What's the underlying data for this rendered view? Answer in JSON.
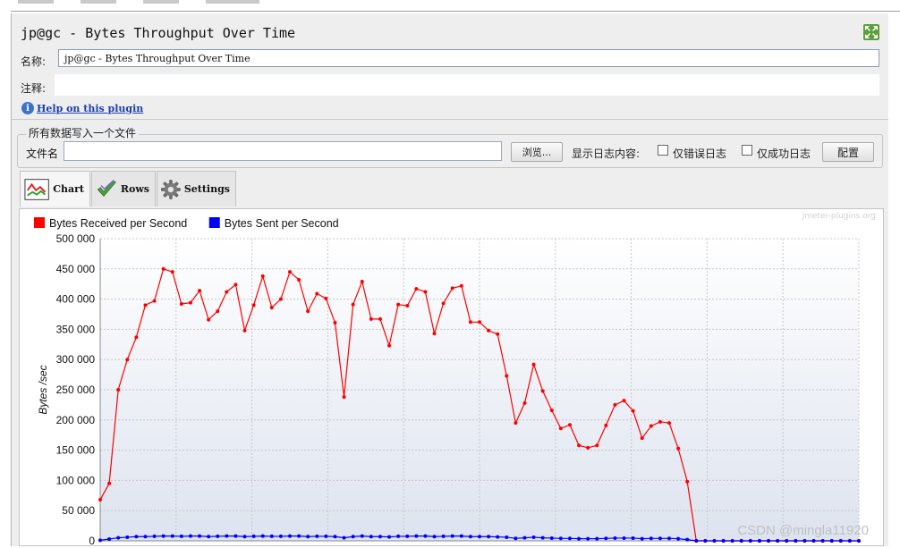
{
  "window": {
    "title": "jp@gc - Bytes Throughput Over Time"
  },
  "form": {
    "name_label": "名称:",
    "name_value": "jp@gc - Bytes Throughput Over Time",
    "comment_label": "注释:",
    "help_link": "Help on this plugin"
  },
  "file": {
    "group_title": "所有数据写入一个文件",
    "filename_label": "文件名",
    "filename_value": "",
    "browse_button": "浏览...",
    "log_display_label": "显示日志内容:",
    "errors_only_label": "仅错误日志",
    "success_only_label": "仅成功日志",
    "config_button": "配置"
  },
  "tabs": [
    {
      "label": "Chart",
      "icon": "chart-icon",
      "active": true
    },
    {
      "label": "Rows",
      "icon": "checkmark-icon",
      "active": false
    },
    {
      "label": "Settings",
      "icon": "gear-icon",
      "active": false
    }
  ],
  "chart": {
    "watermark": "jmeter-plugins.org",
    "footer_watermark": "CSDN @mingla11920"
  },
  "colors": {
    "received": "#ff0000",
    "sent": "#0000ff"
  },
  "chart_data": {
    "type": "line",
    "ylabel": "Bytes /sec",
    "ylim": [
      0,
      500000
    ],
    "yticks": [
      0,
      50000,
      100000,
      150000,
      200000,
      250000,
      300000,
      350000,
      400000,
      450000,
      500000
    ],
    "ytick_labels": [
      "0",
      "50 000",
      "100 000",
      "150 000",
      "200 000",
      "250 000",
      "300 000",
      "350 000",
      "400 000",
      "450 000",
      "500 000"
    ],
    "legend_position": "top-left",
    "grid": true,
    "series": [
      {
        "name": "Bytes Received per Second",
        "color": "#ff0000",
        "values": [
          68000,
          95000,
          250000,
          300000,
          337000,
          390000,
          397000,
          450000,
          445000,
          392000,
          394000,
          414000,
          366000,
          380000,
          412000,
          424000,
          348000,
          390000,
          438000,
          386000,
          400000,
          445000,
          432000,
          380000,
          409000,
          401000,
          361000,
          238000,
          391000,
          429000,
          367000,
          367000,
          323000,
          391000,
          389000,
          417000,
          412000,
          343000,
          393000,
          418000,
          422000,
          362000,
          362000,
          348000,
          342000,
          273000,
          195000,
          228000,
          292000,
          248000,
          216000,
          186000,
          192000,
          158000,
          154000,
          158000,
          191000,
          225000,
          232000,
          215000,
          170000,
          190000,
          197000,
          195000,
          153000,
          98000,
          0,
          0,
          0,
          0,
          0,
          0,
          0,
          0,
          0,
          0,
          0,
          0,
          0,
          0,
          0,
          0,
          0,
          0,
          0
        ]
      },
      {
        "name": "Bytes Sent per Second",
        "color": "#0000ff",
        "values": [
          1000,
          3000,
          5000,
          6000,
          7000,
          7000,
          7500,
          8000,
          8000,
          7500,
          8000,
          8000,
          7000,
          7500,
          8000,
          8000,
          7000,
          7500,
          8000,
          7500,
          7500,
          8000,
          8000,
          7000,
          7500,
          7500,
          7000,
          5000,
          7000,
          8000,
          7000,
          7000,
          6500,
          7500,
          7500,
          8000,
          8000,
          7000,
          7500,
          8000,
          8000,
          7000,
          7000,
          7000,
          6500,
          6000,
          4000,
          5000,
          6000,
          5000,
          4500,
          4000,
          4000,
          3500,
          3500,
          3500,
          4000,
          4500,
          4500,
          4500,
          3500,
          4000,
          4000,
          4000,
          3500,
          2000,
          0,
          0,
          0,
          0,
          0,
          0,
          0,
          0,
          0,
          0,
          0,
          0,
          0,
          0,
          0,
          0,
          0,
          0,
          0
        ]
      }
    ]
  }
}
